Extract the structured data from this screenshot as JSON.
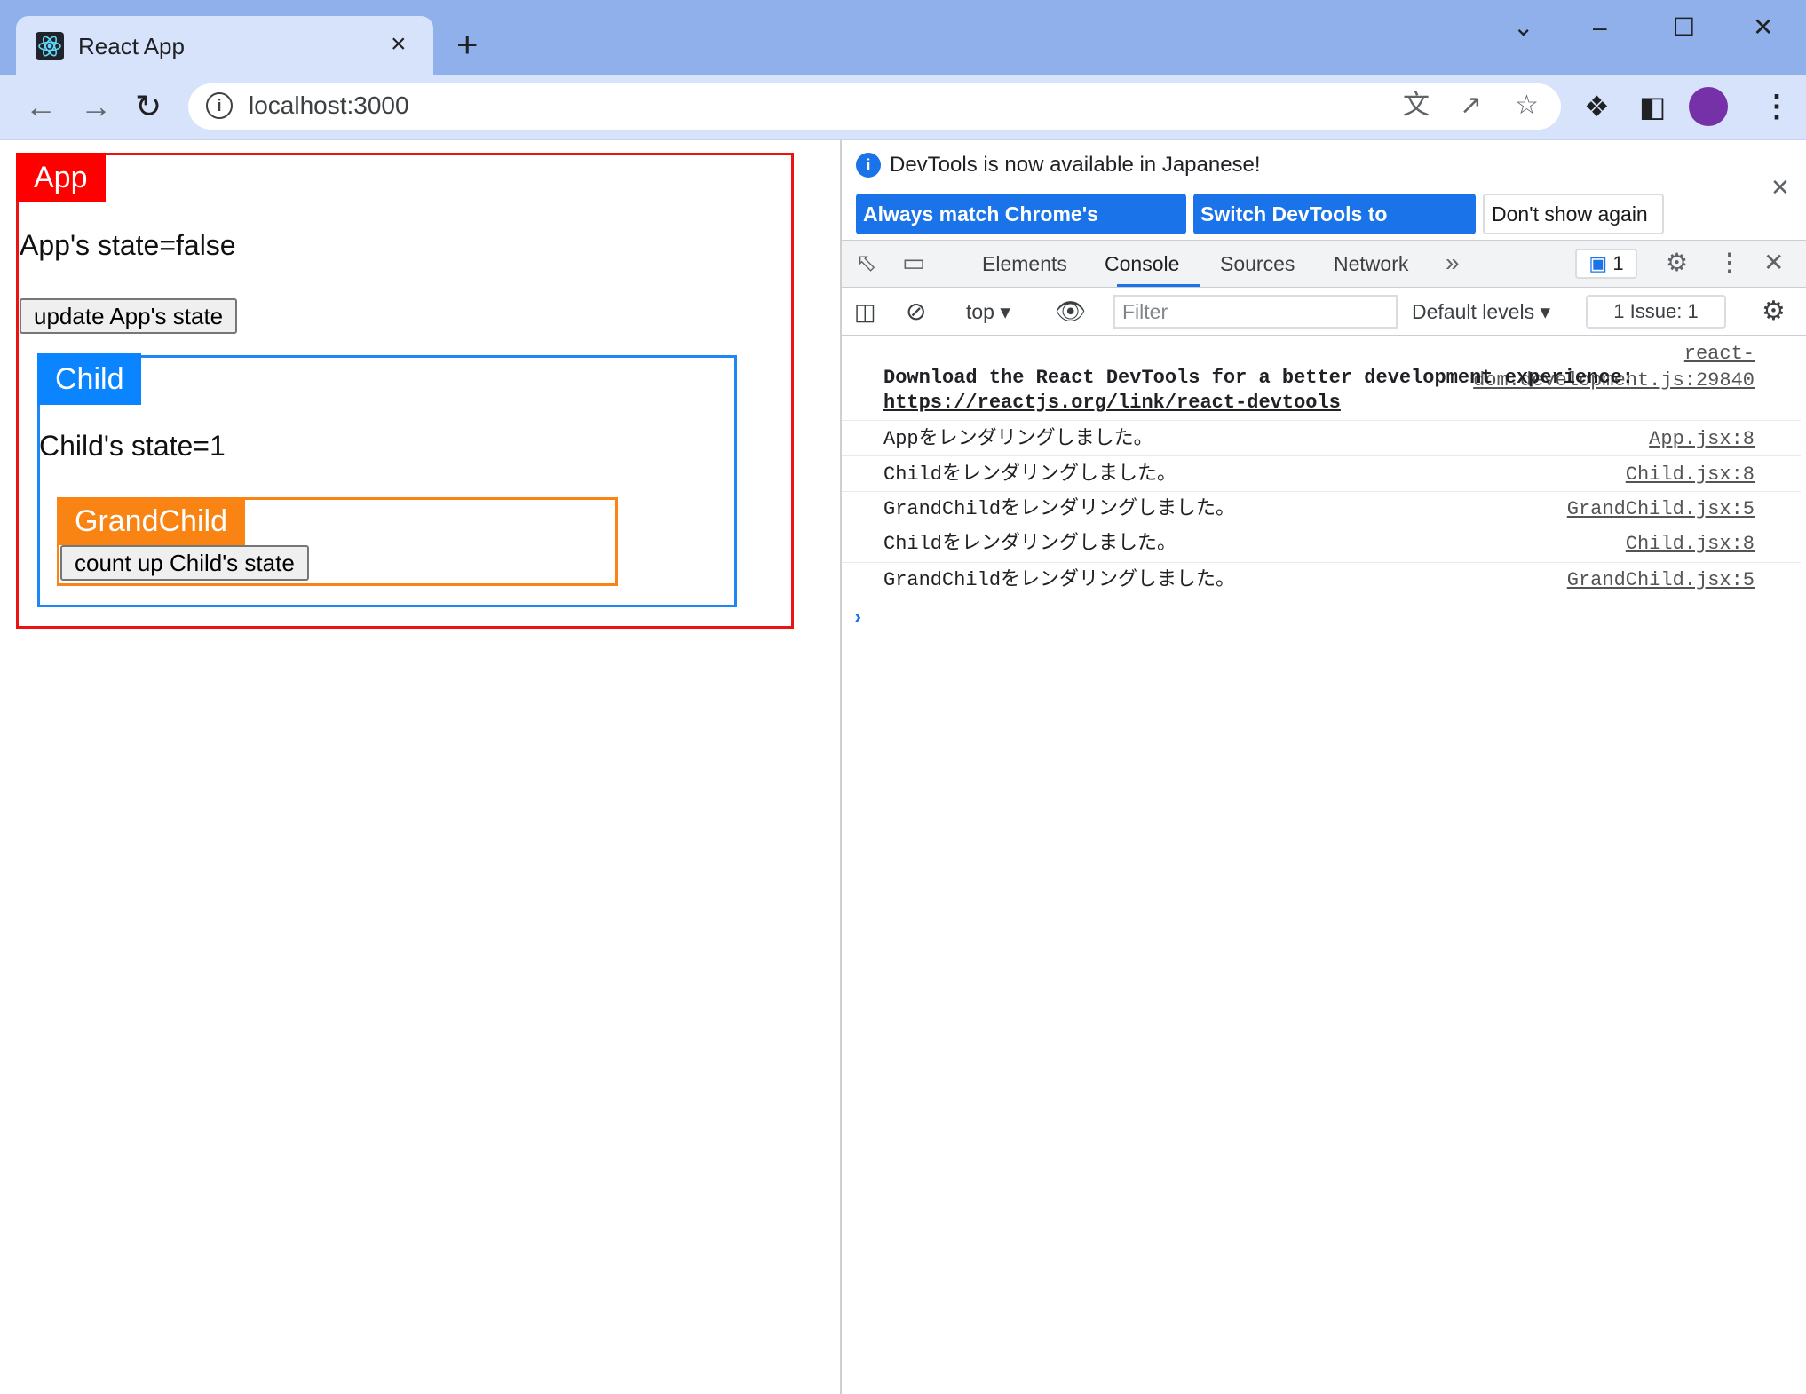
{
  "browser": {
    "tab_title": "React App",
    "tab_close": "×",
    "new_tab": "+",
    "url": "localhost:3000",
    "window_controls": [
      "⌄",
      "–",
      "☐",
      "✕"
    ]
  },
  "page": {
    "app": {
      "tag": "App",
      "state_text": "App's state=false",
      "button_label": "update App's state",
      "color": "#ff0000"
    },
    "child": {
      "tag": "Child",
      "state_text": "Child's state=1",
      "color": "#0b85ff"
    },
    "grandchild": {
      "tag": "GrandChild",
      "button_label": "count up Child's state",
      "color": "#f98313"
    }
  },
  "devtools": {
    "info_text": "DevTools is now available in Japanese!",
    "btn_always": "Always match Chrome's language",
    "btn_switch": "Switch DevTools to Japanese",
    "btn_dont": "Don't show again",
    "tabs": [
      "Elements",
      "Console",
      "Sources",
      "Network"
    ],
    "active_tab": "Console",
    "issues_badge": "1",
    "context": "top",
    "filter_placeholder": "Filter",
    "levels": "Default levels",
    "issue_counter": "1 Issue:  1",
    "messages": [
      {
        "source": "react-dom.development.js:29840",
        "text": "Download the React DevTools for a better development experience: ",
        "link": "https://reactjs.org/link/react-devtools"
      },
      {
        "text": "Appをレンダリングしました。",
        "source": "App.jsx:8"
      },
      {
        "text": "Childをレンダリングしました。",
        "source": "Child.jsx:8"
      },
      {
        "text": "GrandChildをレンダリングしました。",
        "source": "GrandChild.jsx:5"
      },
      {
        "text": "Childをレンダリングしました。",
        "source": "Child.jsx:8"
      },
      {
        "text": "GrandChildをレンダリングしました。",
        "source": "GrandChild.jsx:5"
      }
    ],
    "prompt": "›"
  }
}
